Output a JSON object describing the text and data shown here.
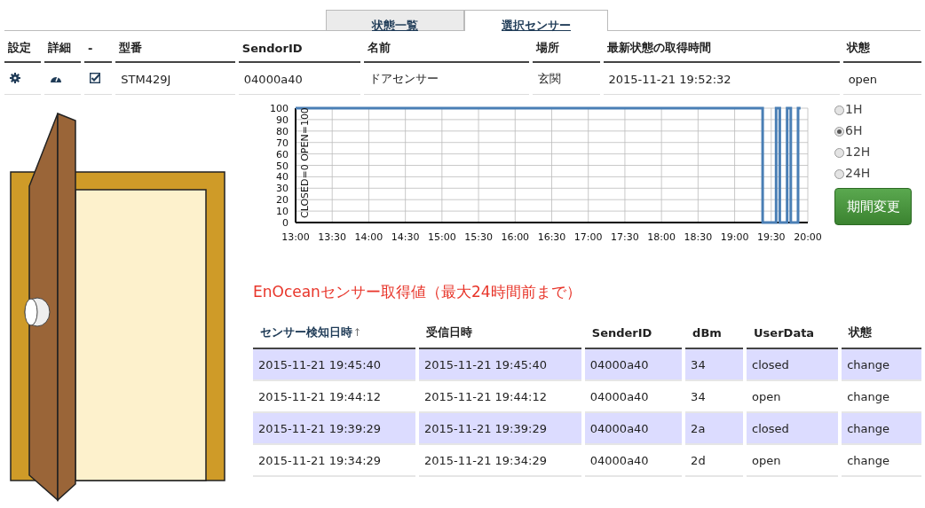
{
  "tabs": [
    {
      "label": "状態一覧",
      "selected": false
    },
    {
      "label": "選択センサー",
      "selected": true
    }
  ],
  "sensor_table": {
    "columns": [
      "設定",
      "詳細",
      "-",
      "型番",
      "SendorID",
      "名前",
      "場所",
      "最新状態の取得時間",
      "状態"
    ],
    "row": {
      "checked": true,
      "model": "STM429J",
      "sender_id": "04000a40",
      "name": "ドアセンサー",
      "location": "玄関",
      "updated": "2015-11-21 19:52:32",
      "status": "open"
    }
  },
  "chart_data": {
    "type": "line",
    "grid": true,
    "ylabel": "CLOSED=0 OPEN=100",
    "ylim": [
      0,
      100
    ],
    "yticks": [
      0,
      10,
      20,
      30,
      40,
      50,
      60,
      70,
      80,
      90,
      100
    ],
    "xlim": [
      13,
      20
    ],
    "xticks": [
      {
        "value": 13,
        "label": "13:00"
      },
      {
        "value": 13.5,
        "label": "13:30"
      },
      {
        "value": 14,
        "label": "14:00"
      },
      {
        "value": 14.5,
        "label": "14:30"
      },
      {
        "value": 15,
        "label": "15:00"
      },
      {
        "value": 15.5,
        "label": "15:30"
      },
      {
        "value": 16,
        "label": "16:00"
      },
      {
        "value": 16.5,
        "label": "16:30"
      },
      {
        "value": 17,
        "label": "17:00"
      },
      {
        "value": 17.5,
        "label": "17:30"
      },
      {
        "value": 18,
        "label": "18:00"
      },
      {
        "value": 18.5,
        "label": "18:30"
      },
      {
        "value": 19,
        "label": "19:00"
      },
      {
        "value": 19.5,
        "label": "19:30"
      },
      {
        "value": 20,
        "label": "20:00"
      }
    ],
    "x": [
      13,
      19.383,
      19.383,
      19.567,
      19.567,
      19.617,
      19.617,
      19.717,
      19.717,
      19.767,
      19.767,
      19.867,
      19.867,
      19.9
    ],
    "series": [
      {
        "color": "#4a7fb5",
        "values": [
          100,
          100,
          0,
          0,
          100,
          100,
          0,
          0,
          100,
          100,
          0,
          0,
          100,
          100
        ]
      }
    ]
  },
  "periods": [
    {
      "label": "1H",
      "selected": false
    },
    {
      "label": "6H",
      "selected": true
    },
    {
      "label": "12H",
      "selected": false
    },
    {
      "label": "24H",
      "selected": false
    }
  ],
  "change_button": "期間変更",
  "section_title": "EnOceanセンサー取得値（最大24時間前まで）",
  "log_table": {
    "columns": [
      "センサー検知日時",
      "受信日時",
      "SenderID",
      "dBm",
      "UserData",
      "状態"
    ],
    "rows": [
      [
        "2015-11-21 19:45:40",
        "2015-11-21 19:45:40",
        "04000a40",
        "34",
        "closed",
        "change"
      ],
      [
        "2015-11-21 19:44:12",
        "2015-11-21 19:44:12",
        "04000a40",
        "34",
        "open",
        "change"
      ],
      [
        "2015-11-21 19:39:29",
        "2015-11-21 19:39:29",
        "04000a40",
        "2a",
        "closed",
        "change"
      ],
      [
        "2015-11-21 19:34:29",
        "2015-11-21 19:34:29",
        "04000a40",
        "2d",
        "open",
        "change"
      ]
    ]
  }
}
